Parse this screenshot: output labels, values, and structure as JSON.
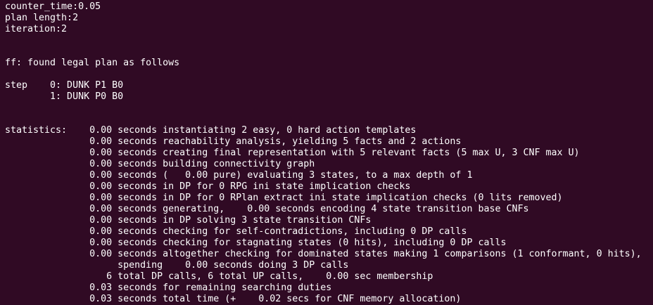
{
  "terminal": {
    "lines": [
      "counter_time:0.05",
      "plan length:2",
      "iteration:2",
      "",
      "",
      "ff: found legal plan as follows",
      "",
      "step    0: DUNK P1 B0",
      "        1: DUNK P0 B0",
      "",
      "",
      "statistics:    0.00 seconds instantiating 2 easy, 0 hard action templates",
      "               0.00 seconds reachability analysis, yielding 5 facts and 2 actions",
      "               0.00 seconds creating final representation with 5 relevant facts (5 max U, 3 CNF max U)",
      "               0.00 seconds building connectivity graph",
      "               0.00 seconds (   0.00 pure) evaluating 3 states, to a max depth of 1",
      "               0.00 seconds in DP for 0 RPG ini state implication checks",
      "               0.00 seconds in DP for 0 RPlan extract ini state implication checks (0 lits removed)",
      "               0.00 seconds generating,    0.00 seconds encoding 4 state transition base CNFs",
      "               0.00 seconds in DP solving 3 state transition CNFs",
      "               0.00 seconds checking for self-contradictions, including 0 DP calls",
      "               0.00 seconds checking for stagnating states (0 hits), including 0 DP calls",
      "               0.00 seconds altogether checking for dominated states making 1 comparisons (1 conformant, 0 hits),",
      "                    spending    0.00 seconds doing 3 DP calls",
      "                  6 total DP calls, 6 total UP calls,    0.00 sec membership",
      "               0.03 seconds for remaining searching duties",
      "               0.03 seconds total time (+    0.02 secs for CNF memory allocation)"
    ]
  }
}
